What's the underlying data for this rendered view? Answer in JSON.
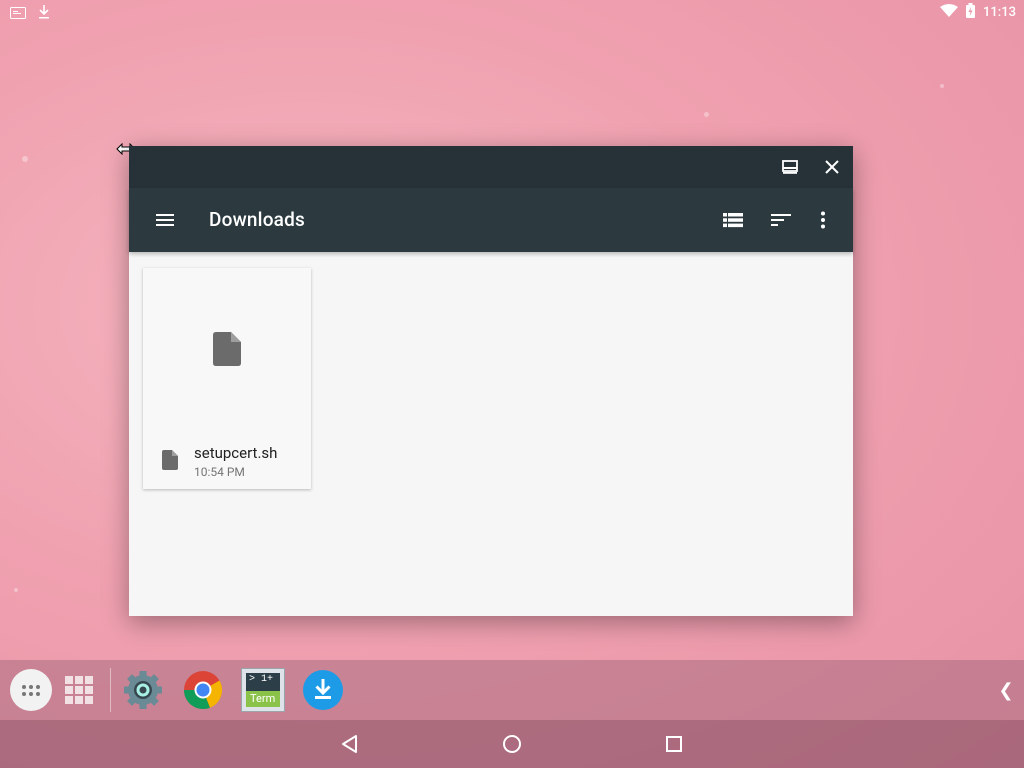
{
  "status_bar": {
    "time": "11:13",
    "left_icons": [
      "screenshot-notification-icon",
      "download-notification-icon"
    ],
    "right_icons": [
      "wifi-icon",
      "battery-charging-icon"
    ]
  },
  "window": {
    "caption_buttons": [
      "maximize-icon",
      "close-icon"
    ],
    "toolbar": {
      "title": "Downloads",
      "actions": [
        "list-view-icon",
        "sort-icon",
        "more-vert-icon"
      ]
    },
    "files": [
      {
        "name": "setupcert.sh",
        "date": "10:54 PM",
        "icon": "file-icon"
      }
    ]
  },
  "taskbar": {
    "items": [
      "all-apps-button",
      "recent-apps-grid",
      "settings-app",
      "chrome-app",
      "terminal-app",
      "downloads-app"
    ],
    "terminal_label_top": "> 1+",
    "terminal_label_bottom": "Term",
    "collapse_arrow": "❮"
  },
  "colors": {
    "caption": "#263238",
    "toolbar": "#2c3a40",
    "content_bg": "#f6f6f6",
    "download_blue": "#1e9be6"
  }
}
